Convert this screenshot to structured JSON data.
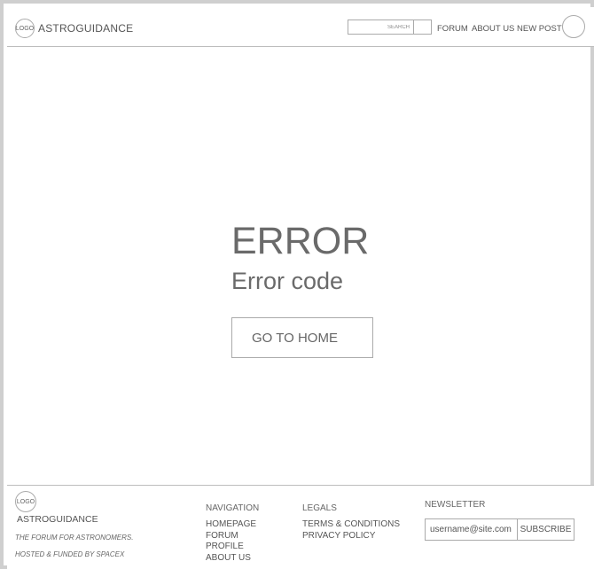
{
  "header": {
    "logo": "LOGO",
    "brand": "ASTROGUIDANCE",
    "search": {
      "placeholder": "SEARCH"
    },
    "nav": [
      "FORUM",
      "ABOUT US",
      "NEW POST"
    ]
  },
  "main": {
    "error_title": "ERROR",
    "error_code": "Error code",
    "home_button": "GO TO HOME"
  },
  "footer": {
    "logo": "LOGO",
    "brand": "ASTROGUIDANCE",
    "tagline": "THE FORUM FOR ASTRONOMERS.",
    "hosted": "HOSTED & FUNDED BY SPACEX",
    "navigation": {
      "heading": "NAVIGATION",
      "items": [
        "HOMEPAGE",
        "FORUM",
        "PROFILE",
        "ABOUT US"
      ]
    },
    "legals": {
      "heading": "LEGALS",
      "items": [
        "TERMS & CONDITIONS",
        "PRIVACY POLICY"
      ]
    },
    "newsletter": {
      "heading": "NEWSLETTER",
      "placeholder": "username@site.com",
      "button": "SUBSCRIBE"
    }
  }
}
